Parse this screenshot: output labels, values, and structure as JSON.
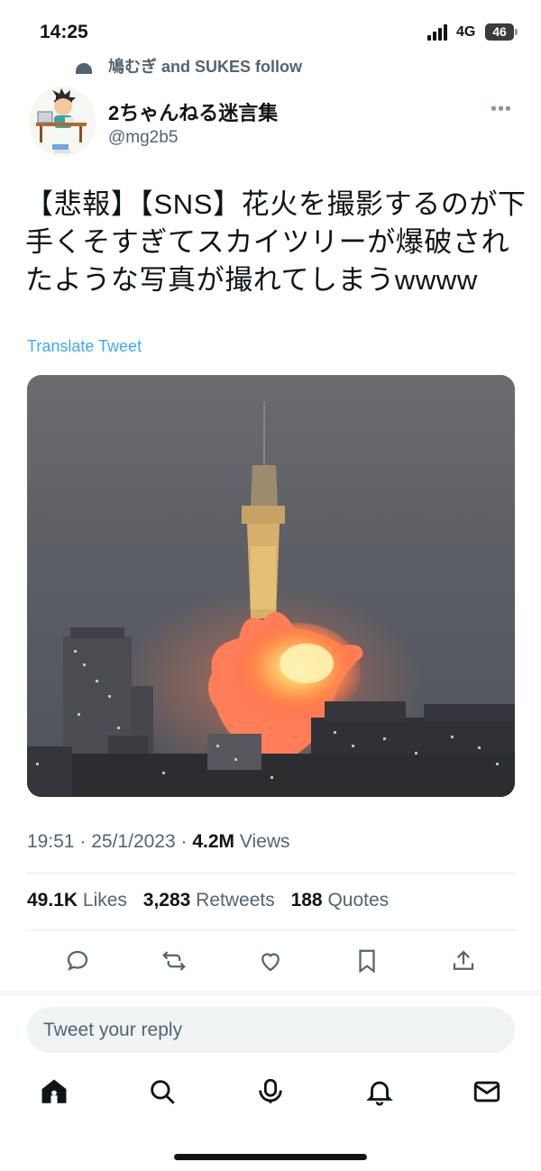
{
  "status_bar": {
    "time": "14:25",
    "network": "4G",
    "battery": "46"
  },
  "social_context": {
    "text": "鳩むぎ and SUKES follow"
  },
  "tweet": {
    "display_name": "2ちゃんねる迷言集",
    "handle": "@mg2b5",
    "text": "【悲報】【SNS】花火を撮影するのが下手くそすぎてスカイツリーが爆破されたような写真が撮れてしまうwwww",
    "translate_label": "Translate Tweet",
    "time": "19:51",
    "date": "25/1/2023",
    "views_count": "4.2M",
    "views_label": "Views",
    "likes_count": "49.1K",
    "likes_label": "Likes",
    "retweets_count": "3,283",
    "retweets_label": "Retweets",
    "quotes_count": "188",
    "quotes_label": "Quotes"
  },
  "actions": [
    "reply-icon",
    "retweet-icon",
    "like-icon",
    "bookmark-icon",
    "share-icon"
  ],
  "reply": {
    "placeholder": "Tweet your reply"
  },
  "tabbar": [
    "home-icon",
    "search-icon",
    "spaces-icon",
    "notifications-icon",
    "messages-icon"
  ],
  "colors": {
    "accent": "#1d9bf0",
    "text": "#0f1419",
    "secondary": "#536471"
  }
}
